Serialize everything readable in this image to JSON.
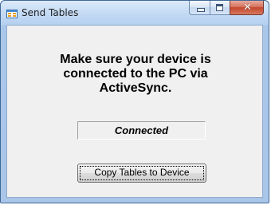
{
  "window": {
    "title": "Send Tables",
    "icon": "app-window-icon",
    "caption_buttons": {
      "minimize": "minimize-icon",
      "maximize": "maximize-icon",
      "close_glyph": "✕"
    }
  },
  "main": {
    "instruction": "Make sure your device is\nconnected to the PC via\nActiveSync.",
    "status": "Connected",
    "copy_button_label": "Copy Tables to Device"
  },
  "colors": {
    "title_bar": "#c5dbf4",
    "close_button": "#c4452c",
    "client_background": "#f0f0f0"
  }
}
